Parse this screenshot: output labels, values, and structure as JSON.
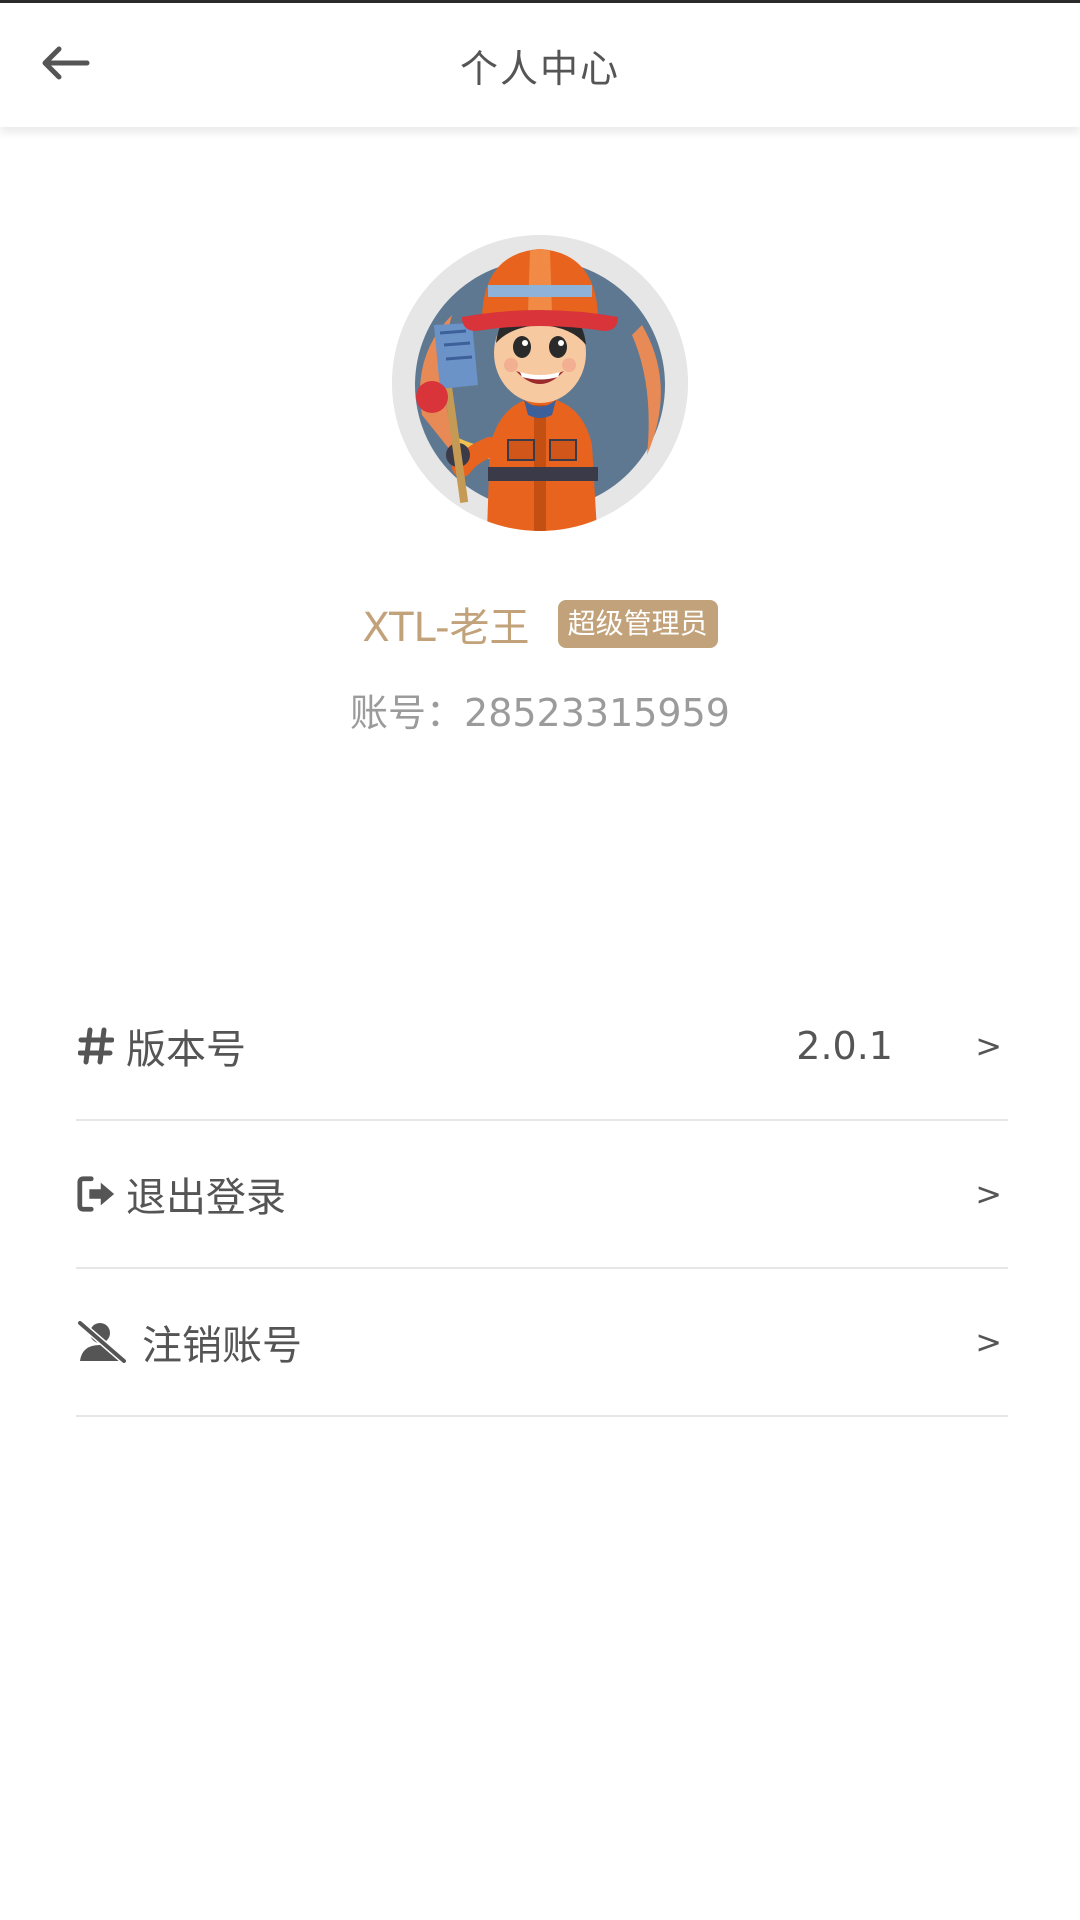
{
  "header": {
    "title": "个人中心",
    "back_icon": "arrow-left-icon"
  },
  "profile": {
    "name": "XTL-老王",
    "role_badge": "超级管理员",
    "account_text": "账号：28523315959",
    "avatar": "worker-avatar-illustration"
  },
  "menu": [
    {
      "icon": "hash-icon",
      "label": "版本号",
      "value": "2.0.1",
      "chevron": ">"
    },
    {
      "icon": "logout-icon",
      "label": "退出登录",
      "chevron": ">"
    },
    {
      "icon": "user-slash-icon",
      "label": "注销账号",
      "chevron": ">"
    }
  ],
  "colors": {
    "accent": "#c2a27a",
    "text": "#555555",
    "muted": "#9b9b9b",
    "divider": "#e6e6e6"
  }
}
